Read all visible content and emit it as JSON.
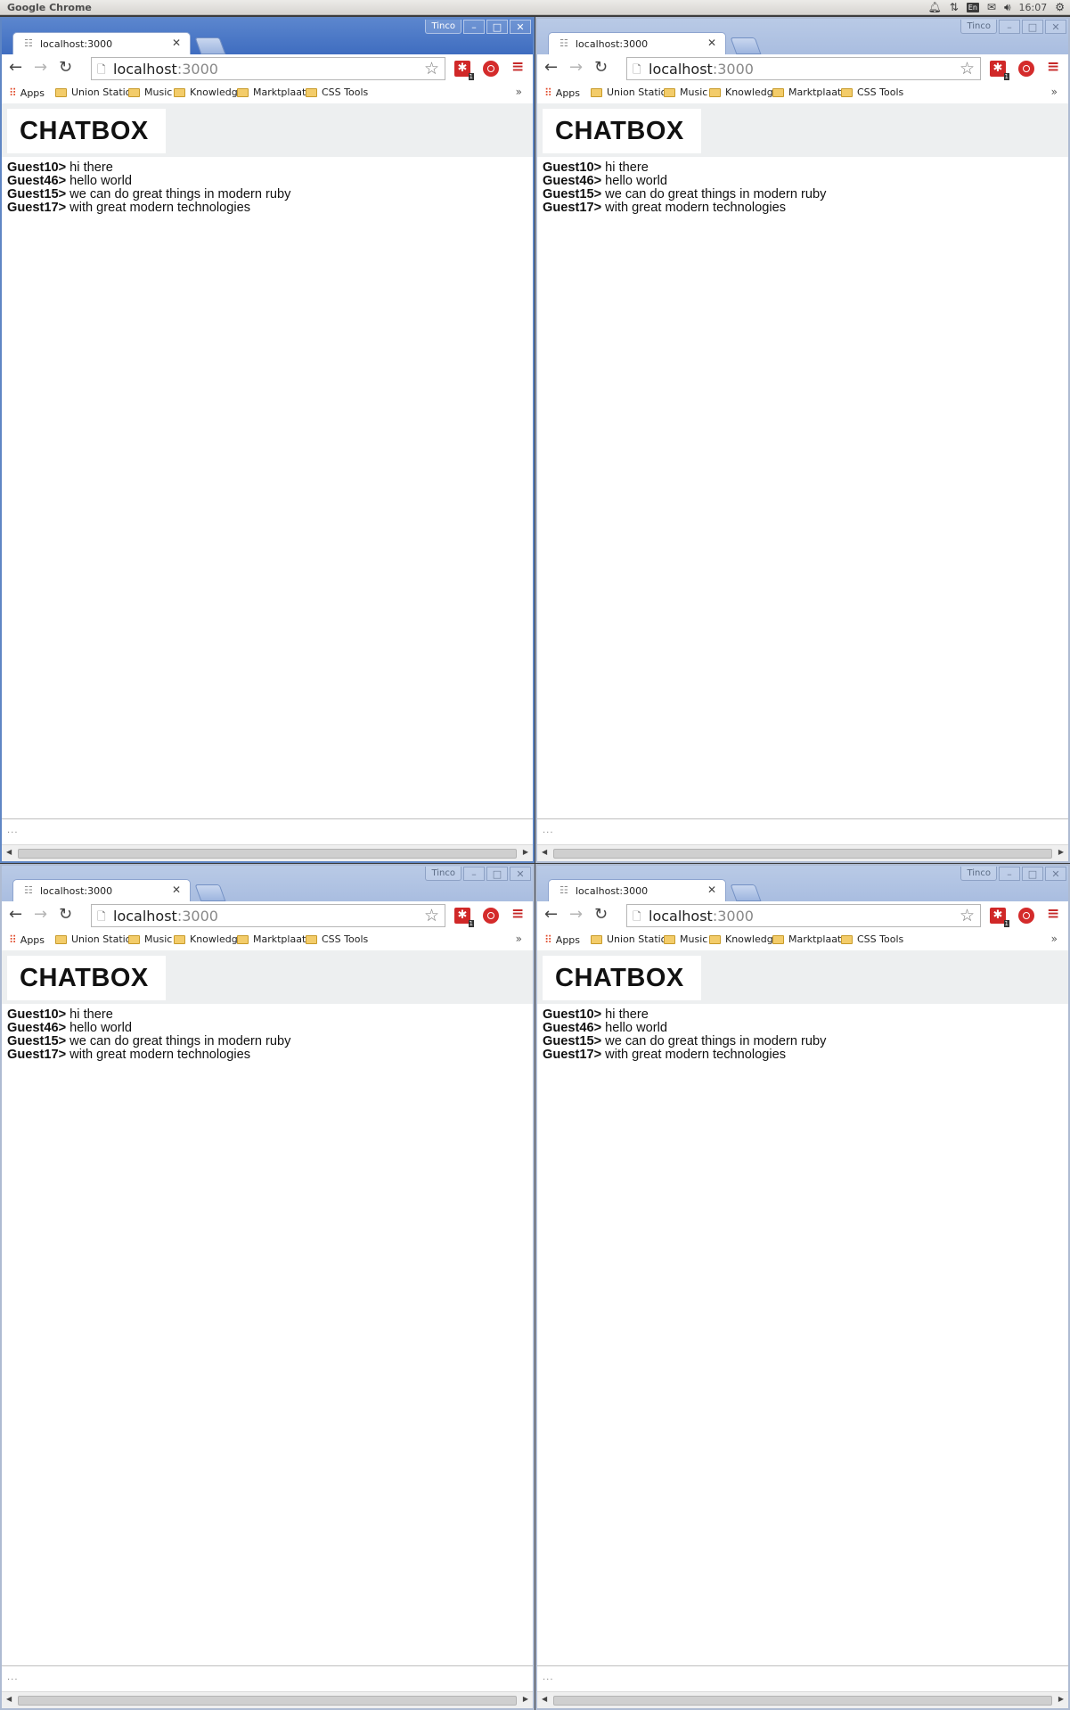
{
  "os_panel": {
    "app_name": "Google Chrome",
    "lang": "En",
    "clock": "16:07"
  },
  "browser": {
    "profile_name": "Tinco",
    "tab_title": "localhost:3000",
    "url_host": "localhost",
    "url_port": ":3000",
    "bookmarks": {
      "apps": "Apps",
      "items": [
        "Union Station",
        "Music",
        "Knowledge",
        "Marktplaats",
        "CSS Tools"
      ],
      "more": "»"
    }
  },
  "page": {
    "logo": "CHATBOX",
    "messages": [
      {
        "user": "Guest10>",
        "text": " hi there"
      },
      {
        "user": "Guest46>",
        "text": " hello world"
      },
      {
        "user": "Guest15>",
        "text": " we can do great things in modern ruby"
      },
      {
        "user": "Guest17>",
        "text": " with great modern technologies"
      }
    ],
    "input_placeholder": "..."
  }
}
